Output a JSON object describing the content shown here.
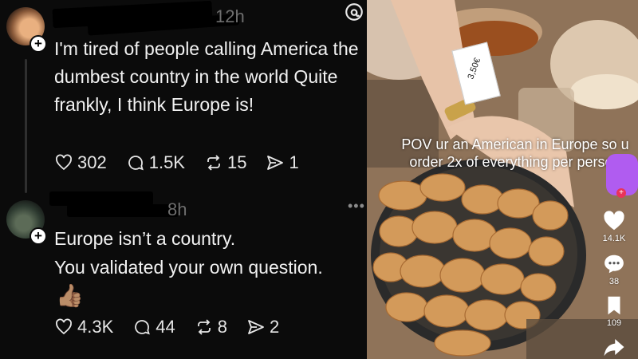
{
  "threads": {
    "post1": {
      "time": "12h",
      "text": "I'm tired of people calling America the dumbest country in the world Quite frankly, I think Europe is!",
      "likes": "302",
      "replies": "1.5K",
      "reposts": "15",
      "shares": "1"
    },
    "post2": {
      "time": "8h",
      "line1": "Europe isn’t a country.",
      "line2": "You validated your own question.",
      "emoji": "👍🏽",
      "likes": "4.3K",
      "replies": "44",
      "reposts": "8",
      "shares": "2",
      "more": "•••"
    },
    "plus": "+"
  },
  "tiktok": {
    "caption": "POV ur an American in Europe so u order 2x of everything per person",
    "price": "3,50€",
    "likes": "14.1K",
    "comments": "38",
    "saves": "109",
    "avatar_badge": "+"
  },
  "colors": {
    "threads_bg": "#0b0b0b",
    "text": "#f2f2f2",
    "tiktok_blob": "#b05cf0"
  },
  "icons": [
    "heart-icon",
    "comment-icon",
    "repost-icon",
    "share-icon",
    "threads-logo-icon",
    "bookmark-icon",
    "tiktok-share-icon"
  ]
}
